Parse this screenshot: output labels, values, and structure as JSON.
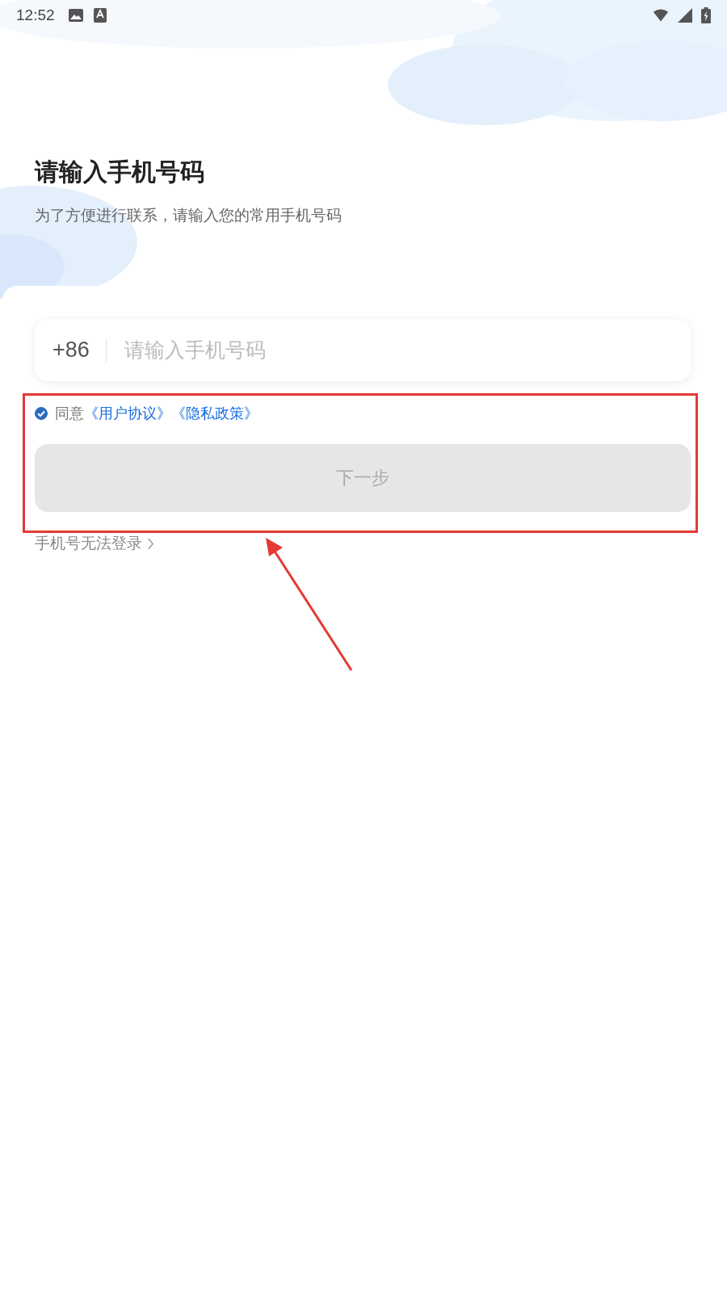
{
  "status_bar": {
    "time": "12:52"
  },
  "header": {
    "title": "请输入手机号码",
    "subtitle": "为了方便进行联系，请输入您的常用手机号码"
  },
  "phone_field": {
    "country_code": "+86",
    "placeholder": "请输入手机号码"
  },
  "agreement": {
    "checked": true,
    "text": "同意",
    "links": [
      "《用户协议》",
      "《隐私政策》"
    ]
  },
  "next_button": {
    "label": "下一步",
    "disabled": true
  },
  "help_link": {
    "label": "手机号无法登录"
  },
  "annotation": {
    "kind": "highlight-box-with-arrow"
  }
}
